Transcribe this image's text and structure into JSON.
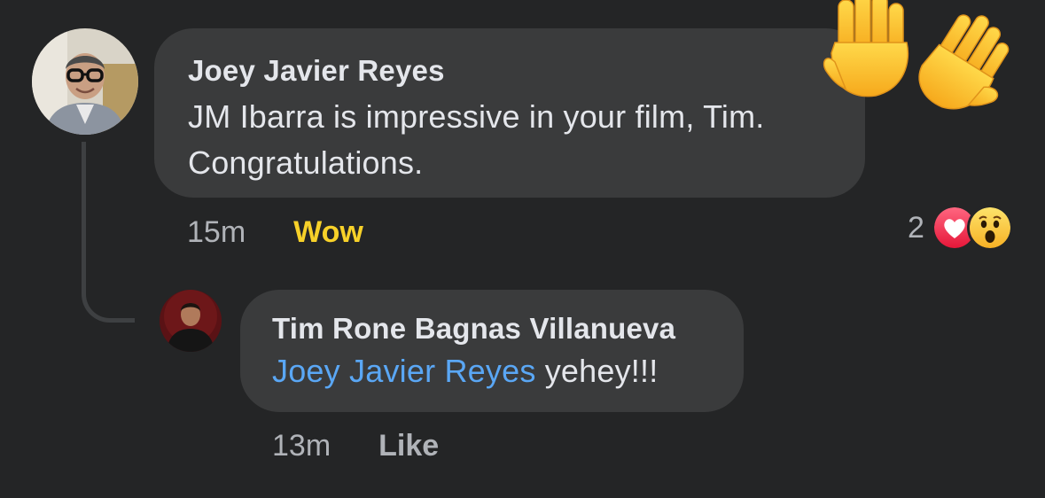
{
  "comments": [
    {
      "author": "Joey Javier Reyes",
      "text": "JM Ibarra is impressive in your film, Tim. Congratulations.",
      "time": "15m",
      "reaction_action": "Wow",
      "reaction_count": "2",
      "reaction_icons": [
        "heart-reaction",
        "wow-reaction"
      ]
    },
    {
      "author": "Tim Rone Bagnas Villanueva",
      "mention": "Joey Javier Reyes",
      "text": " yehey!!!",
      "time": "13m",
      "reaction_action": "Like"
    }
  ],
  "colors": {
    "background": "#242526",
    "bubble": "#3a3b3c",
    "text": "#e4e6eb",
    "secondary_text": "#b0b3b8",
    "mention": "#5aa7f5",
    "wow_action": "#f7d129",
    "heart_reaction": "#f33e58"
  },
  "decorations": {
    "emoji": "waving-hands"
  }
}
